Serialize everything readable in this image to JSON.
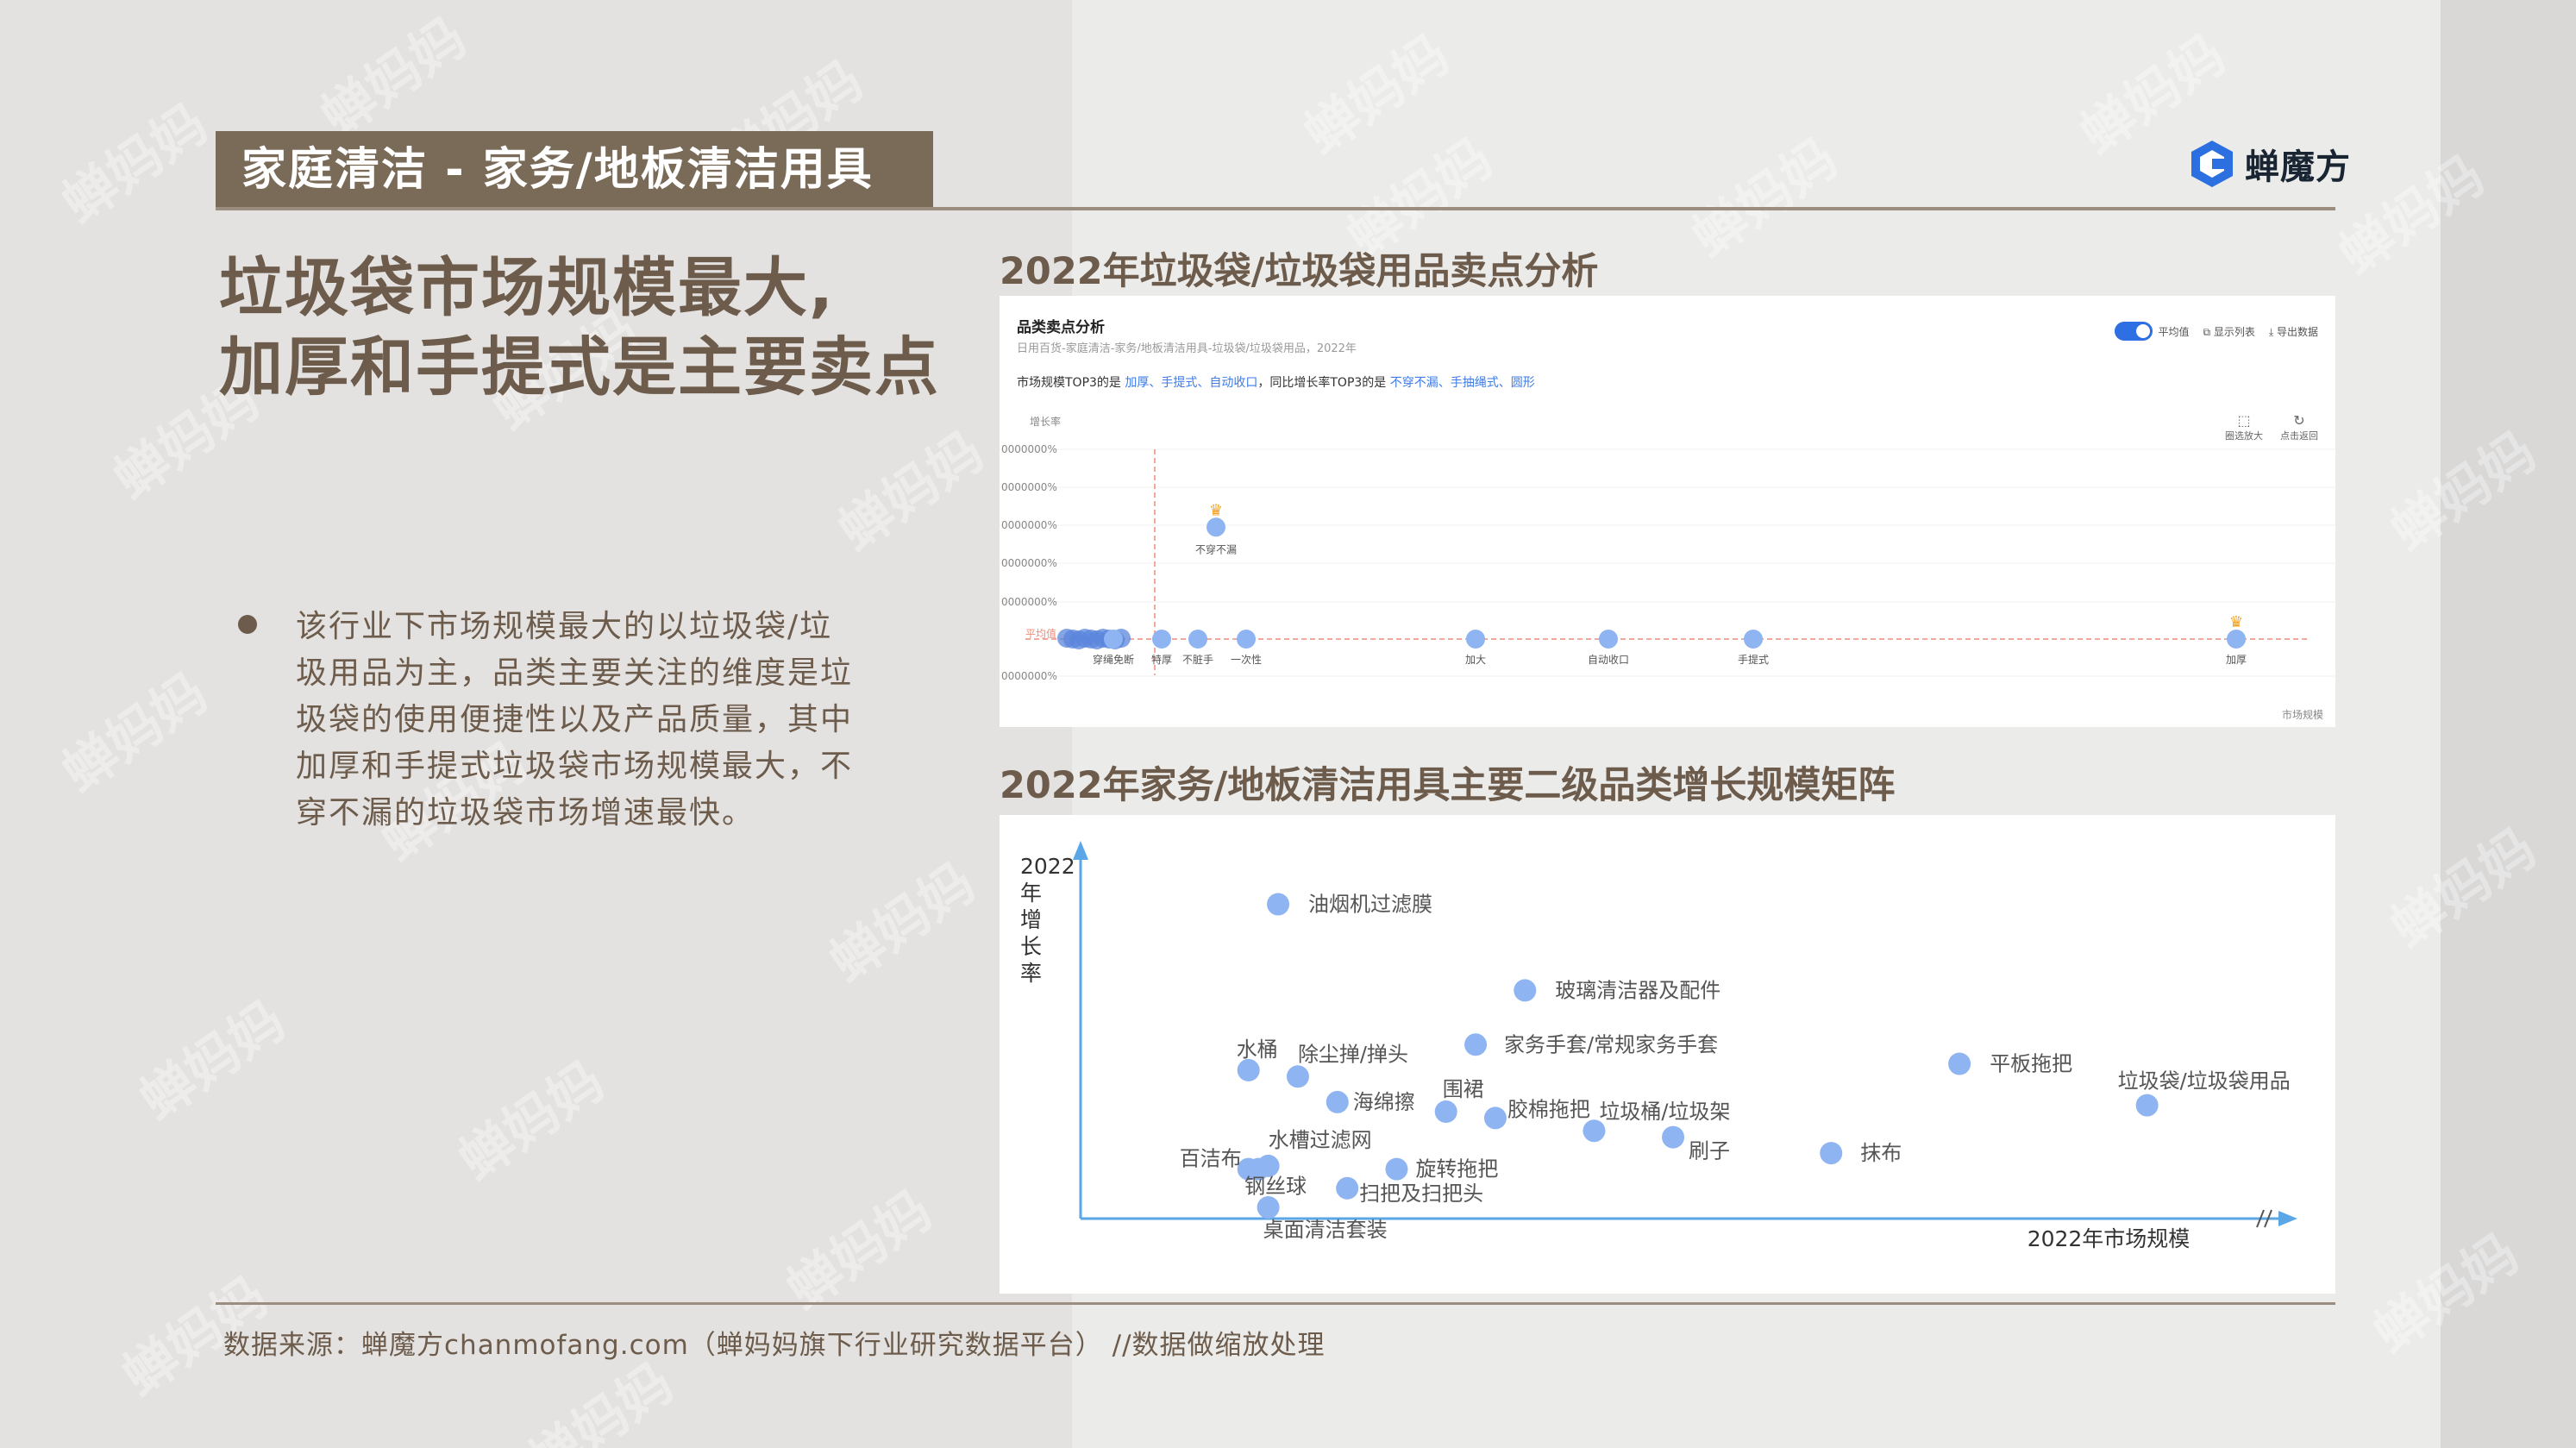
{
  "header": {
    "section_tag": "家庭清洁 - 家务/地板清洁用具",
    "brand_name": "蝉魔方"
  },
  "watermark_text": "蝉妈妈",
  "headline": {
    "line1": "垃圾袋市场规模最大,",
    "line2": "加厚和手提式是主要卖点"
  },
  "bullet": "该行业下市场规模最大的以垃圾袋/垃圾用品为主，品类主要关注的维度是垃圾袋的使用便捷性以及产品质量，其中加厚和手提式垃圾袋市场规模最大，不穿不漏的垃圾袋市场增速最快。",
  "section1_title": "2022年垃圾袋/垃圾袋用品卖点分析",
  "section2_title": "2022年家务/地板清洁用具主要二级品类增长规模矩阵",
  "panel1": {
    "title": "品类卖点分析",
    "path": "日用百货-家庭清洁-家务/地板清洁用具-垃圾袋/垃圾袋用品，2022年",
    "summary_prefix": "市场规模TOP3的是 ",
    "summary_top3": "加厚、手提式、自动收口",
    "summary_mid": "，同比增长率TOP3的是 ",
    "summary_growth3": "不穿不漏、手抽绳式、圆形",
    "tool_avg": "平均值",
    "tool_list": "显示列表",
    "tool_export": "导出数据",
    "zoom_label": "圈选放大",
    "reset_label": "点击返回"
  },
  "chart_data": [
    {
      "type": "scatter",
      "title": "品类卖点分析",
      "xlabel": "市场规模",
      "ylabel": "增长率",
      "y_tick_labels": [
        "0000000%",
        "0000000%",
        "0000000%",
        "0000000%",
        "0000000%",
        "0000000%"
      ],
      "avg_label": "平均值",
      "points": [
        {
          "label": "不穿不漏",
          "x": 0.115,
          "y": 0.94,
          "crown": true
        },
        {
          "label": "穿绳免断",
          "x": 0.03,
          "y": 0.0
        },
        {
          "label": "特厚",
          "x": 0.07,
          "y": 0.0
        },
        {
          "label": "不脏手",
          "x": 0.1,
          "y": 0.0
        },
        {
          "label": "一次性",
          "x": 0.14,
          "y": 0.0
        },
        {
          "label": "加大",
          "x": 0.33,
          "y": 0.0
        },
        {
          "label": "自动收口",
          "x": 0.44,
          "y": 0.0
        },
        {
          "label": "手提式",
          "x": 0.56,
          "y": 0.0
        },
        {
          "label": "加厚",
          "x": 0.96,
          "y": 0.0,
          "crown": true
        }
      ]
    },
    {
      "type": "scatter",
      "title": "2022年家务/地板清洁用具主要二级品类增长规模矩阵",
      "xlabel": "2022年市场规模",
      "ylabel": "2022年增长率",
      "points": [
        {
          "label": "油烟机过滤膜",
          "x": 0.09,
          "y": 0.95
        },
        {
          "label": "玻璃清洁器及配件",
          "x": 0.34,
          "y": 0.68
        },
        {
          "label": "家务手套/常规家务手套",
          "x": 0.29,
          "y": 0.51
        },
        {
          "label": "水桶",
          "x": 0.06,
          "y": 0.43
        },
        {
          "label": "除尘掸/掸头",
          "x": 0.11,
          "y": 0.41
        },
        {
          "label": "平板拖把",
          "x": 0.78,
          "y": 0.45
        },
        {
          "label": "垃圾袋/垃圾袋用品",
          "x": 0.97,
          "y": 0.32
        },
        {
          "label": "海绵擦",
          "x": 0.15,
          "y": 0.33
        },
        {
          "label": "围裙",
          "x": 0.26,
          "y": 0.3
        },
        {
          "label": "胶棉拖把",
          "x": 0.31,
          "y": 0.28
        },
        {
          "label": "垃圾桶/垃圾架",
          "x": 0.41,
          "y": 0.24
        },
        {
          "label": "刷子",
          "x": 0.49,
          "y": 0.22
        },
        {
          "label": "抹布",
          "x": 0.65,
          "y": 0.17
        },
        {
          "label": "百洁布",
          "x": 0.06,
          "y": 0.12
        },
        {
          "label": "水槽过滤网",
          "x": 0.08,
          "y": 0.13
        },
        {
          "label": "旋转拖把",
          "x": 0.21,
          "y": 0.12
        },
        {
          "label": "扫把及扫把头",
          "x": 0.16,
          "y": 0.06
        },
        {
          "label": "钢丝球",
          "x": 0.07,
          "y": 0.12
        },
        {
          "label": "桌面清洁套装",
          "x": 0.08,
          "y": 0.0
        }
      ]
    }
  ],
  "footer": "数据来源：蝉魔方chanmofang.com（蝉妈妈旗下行业研究数据平台） //数据做缩放处理",
  "colors": {
    "accent_brown": "#7a6a58",
    "text_brown": "#6d5c4b",
    "dot_blue": "#8fb4f2",
    "axis_blue": "#5aa6e6",
    "avg_red": "#f08a7a"
  }
}
